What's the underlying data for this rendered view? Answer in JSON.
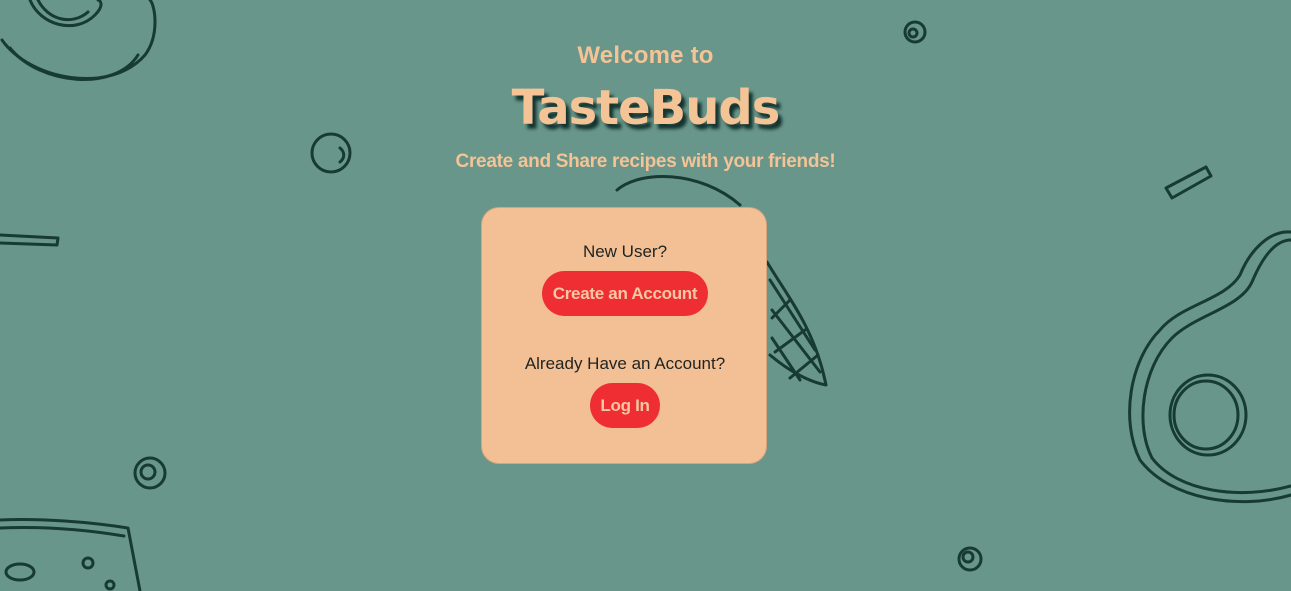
{
  "hero": {
    "welcome": "Welcome to",
    "brand": "TasteBuds",
    "tagline": "Create and Share recipes with your friends!"
  },
  "card": {
    "new_user_prompt": "New User?",
    "create_account_label": "Create an Account",
    "existing_user_prompt": "Already Have an Account?",
    "login_label": "Log In"
  },
  "colors": {
    "background": "#68968a",
    "doodle_stroke": "#173a35",
    "accent_text": "#f4c396",
    "card_background": "#f3c095",
    "button": "#ef2e33",
    "button_text": "#f6c7a3"
  },
  "background_pattern": "food-doodles"
}
